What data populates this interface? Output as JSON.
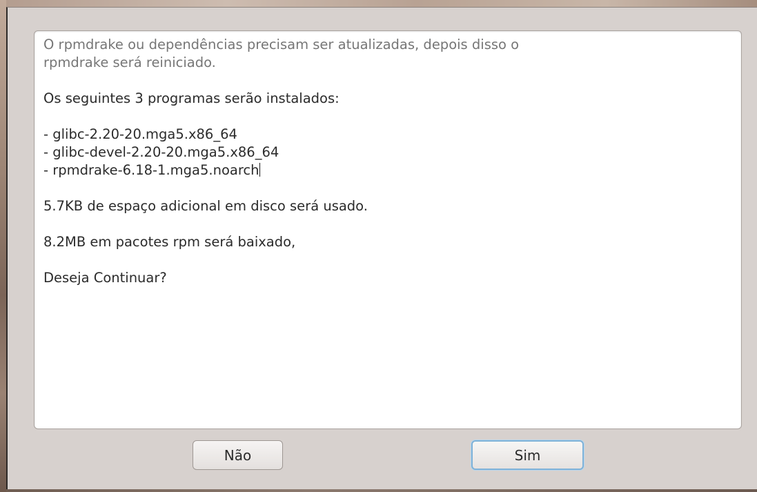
{
  "dialog": {
    "message": {
      "header_line1": "O rpmdrake ou dependências precisam ser atualizadas, depois disso o",
      "header_line2": "rpmdrake será reiniciado.",
      "install_intro": "Os seguintes 3 programas serão instalados:",
      "packages": [
        "- glibc-2.20-20.mga5.x86_64",
        "- glibc-devel-2.20-20.mga5.x86_64",
        "- rpmdrake-6.18-1.mga5.noarch"
      ],
      "disk_space": "5.7KB de espaço adicional em disco será usado.",
      "download_size": "8.2MB em pacotes rpm será baixado,",
      "question": "Deseja Continuar?"
    },
    "buttons": {
      "no_label": "Não",
      "yes_label": "Sim"
    }
  }
}
